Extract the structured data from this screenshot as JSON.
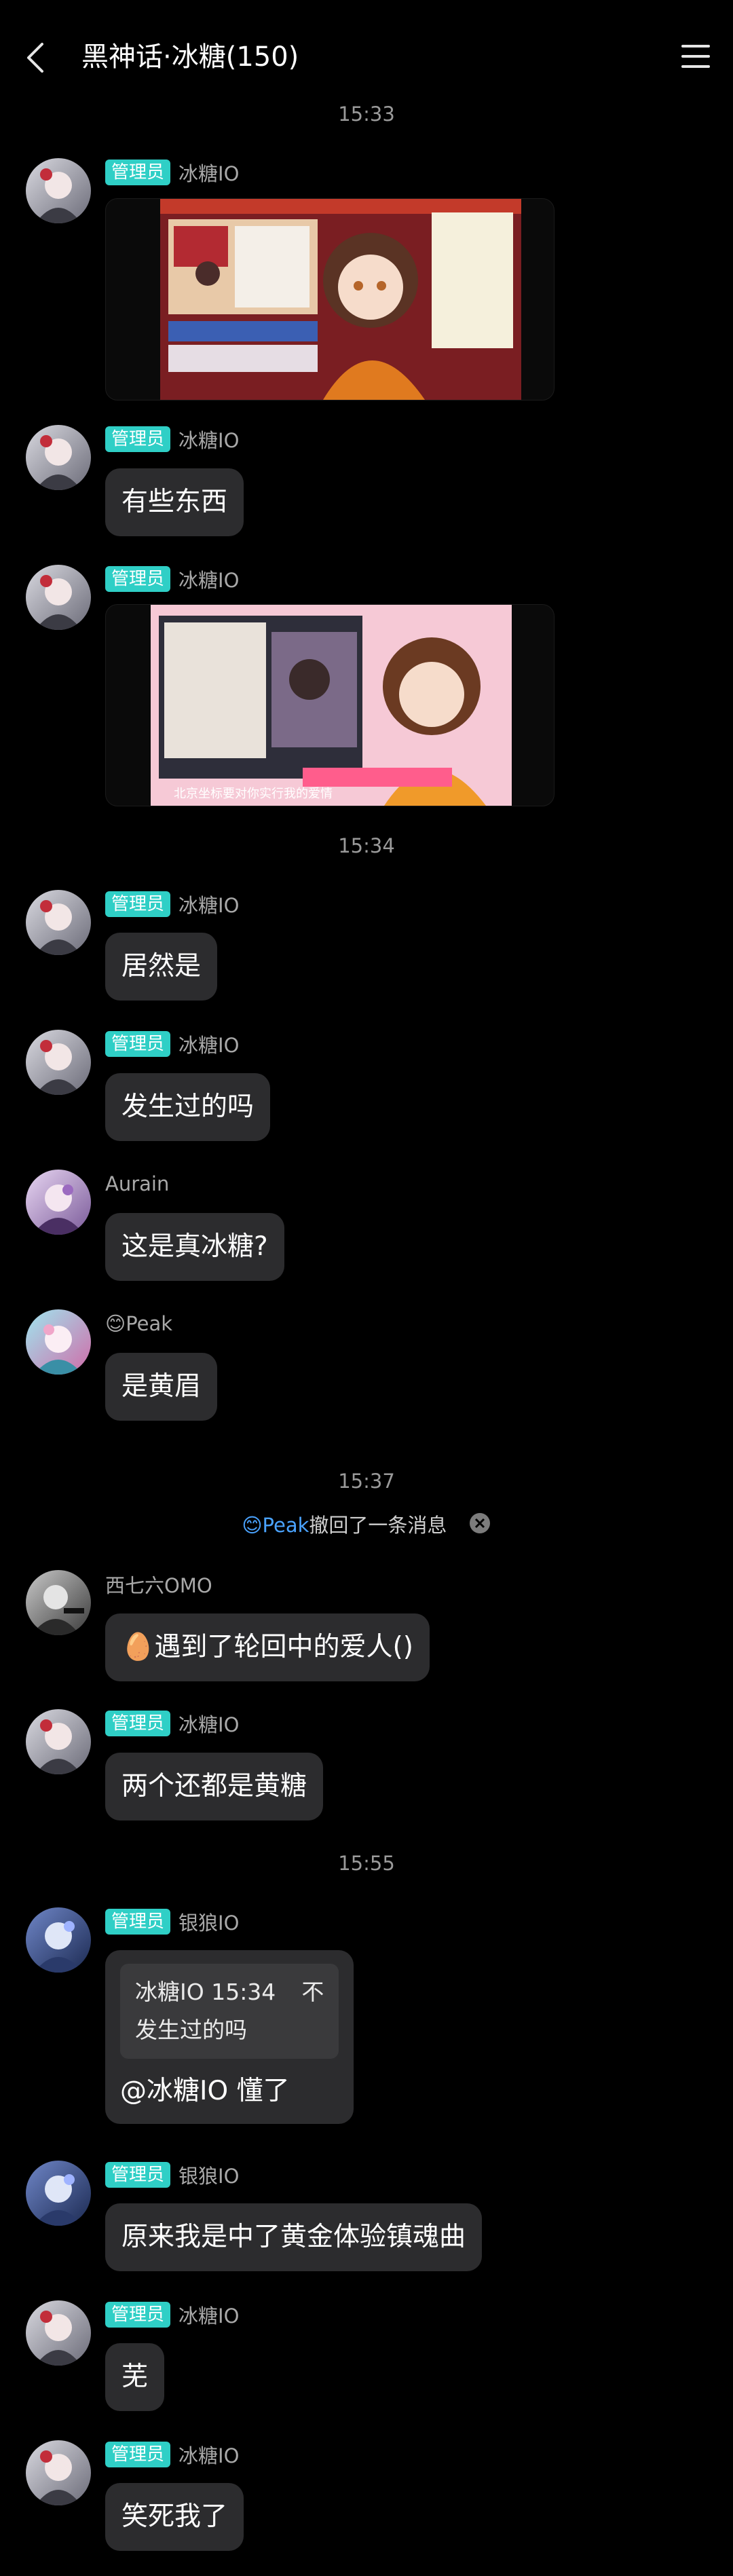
{
  "header": {
    "title": "黑神话·冰糖(150)"
  },
  "colors": {
    "background": "#000000",
    "bubble": "#2c2c2e",
    "admin_badge": "#2fcfc6",
    "link_name": "#4aa3ff"
  },
  "timestamps": [
    "15:33",
    "15:34",
    "15:37",
    "15:55"
  ],
  "messages": [
    {
      "badge": "管理员",
      "sender": "冰糖IO",
      "kind": "image",
      "image_icon": "video-screenshot-vtuber-stream"
    },
    {
      "badge": "管理员",
      "sender": "冰糖IO",
      "text": "有些东西"
    },
    {
      "badge": "管理员",
      "sender": "冰糖IO",
      "kind": "image",
      "image_icon": "video-screenshot-vtuber-caption",
      "image_caption": "北京坐标要对你实行我的爱情"
    },
    {
      "badge": "管理员",
      "sender": "冰糖IO",
      "text": "居然是"
    },
    {
      "badge": "管理员",
      "sender": "冰糖IO",
      "text": "发生过的吗"
    },
    {
      "sender": "Aurain",
      "text": "这是真冰糖?"
    },
    {
      "sender": "😊Peak",
      "text": "是黄眉"
    },
    {
      "sender": "西七六OMO",
      "text": "🥚遇到了轮回中的爱人()"
    },
    {
      "badge": "管理员",
      "sender": "冰糖IO",
      "text": "两个还都是黄糖"
    },
    {
      "badge": "管理员",
      "sender": "银狼IO",
      "quote_line1": "冰糖IO 15:34",
      "quote_trail": "不",
      "quote_line2": "发生过的吗",
      "text": "@冰糖IO 懂了"
    },
    {
      "badge": "管理员",
      "sender": "银狼IO",
      "text": "原来我是中了黄金体验镇魂曲"
    },
    {
      "badge": "管理员",
      "sender": "冰糖IO",
      "text": "芜"
    },
    {
      "badge": "管理员",
      "sender": "冰糖IO",
      "text": "笑死我了"
    }
  ],
  "recall": {
    "name": "😊Peak",
    "text": "撤回了一条消息"
  }
}
